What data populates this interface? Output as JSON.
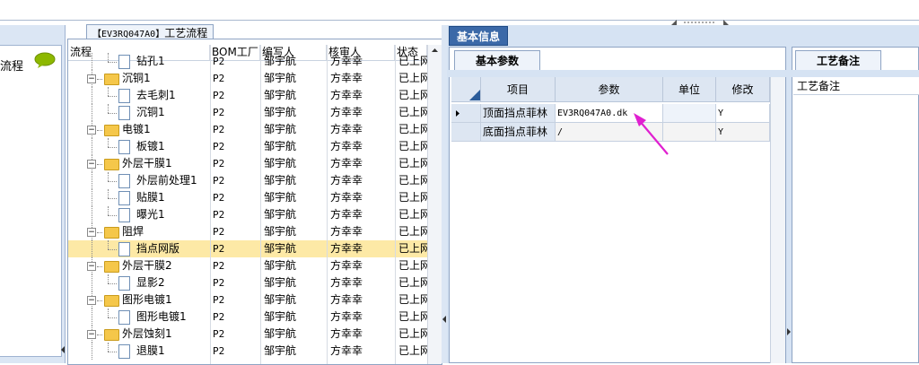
{
  "left_panel": {
    "label": "流程"
  },
  "workflow": {
    "title_code": "【EV3RQ047A0】",
    "title_text": "工艺流程",
    "columns": {
      "flow": "流程",
      "bom": "BOM工厂",
      "writer": "编写人",
      "reviewer": "核审人",
      "status": "状态"
    },
    "rows": [
      {
        "name": "钻孔1",
        "type": "doc",
        "level": 1,
        "bom": "P2",
        "writer": "邹宇航",
        "reviewer": "方幸幸",
        "status": "已上网"
      },
      {
        "name": "沉铜1",
        "type": "folder",
        "level": 0,
        "bom": "P2",
        "writer": "邹宇航",
        "reviewer": "方幸幸",
        "status": "已上网"
      },
      {
        "name": "去毛刺1",
        "type": "doc",
        "level": 1,
        "bom": "P2",
        "writer": "邹宇航",
        "reviewer": "方幸幸",
        "status": "已上网"
      },
      {
        "name": "沉铜1",
        "type": "doc",
        "level": 1,
        "bom": "P2",
        "writer": "邹宇航",
        "reviewer": "方幸幸",
        "status": "已上网"
      },
      {
        "name": "电镀1",
        "type": "folder",
        "level": 0,
        "bom": "P2",
        "writer": "邹宇航",
        "reviewer": "方幸幸",
        "status": "已上网"
      },
      {
        "name": "板镀1",
        "type": "doc",
        "level": 1,
        "bom": "P2",
        "writer": "邹宇航",
        "reviewer": "方幸幸",
        "status": "已上网"
      },
      {
        "name": "外层干膜1",
        "type": "folder",
        "level": 0,
        "bom": "P2",
        "writer": "邹宇航",
        "reviewer": "方幸幸",
        "status": "已上网"
      },
      {
        "name": "外层前处理1",
        "type": "doc",
        "level": 1,
        "bom": "P2",
        "writer": "邹宇航",
        "reviewer": "方幸幸",
        "status": "已上网"
      },
      {
        "name": "贴膜1",
        "type": "doc",
        "level": 1,
        "bom": "P2",
        "writer": "邹宇航",
        "reviewer": "方幸幸",
        "status": "已上网"
      },
      {
        "name": "曝光1",
        "type": "doc",
        "level": 1,
        "bom": "P2",
        "writer": "邹宇航",
        "reviewer": "方幸幸",
        "status": "已上网"
      },
      {
        "name": "阻焊",
        "type": "folder",
        "level": 0,
        "bom": "P2",
        "writer": "邹宇航",
        "reviewer": "方幸幸",
        "status": "已上网"
      },
      {
        "name": "挡点网版",
        "type": "doc",
        "level": 1,
        "bom": "P2",
        "writer": "邹宇航",
        "reviewer": "方幸幸",
        "status": "已上网",
        "selected": true
      },
      {
        "name": "外层干膜2",
        "type": "folder",
        "level": 0,
        "bom": "P2",
        "writer": "邹宇航",
        "reviewer": "方幸幸",
        "status": "已上网"
      },
      {
        "name": "显影2",
        "type": "doc",
        "level": 1,
        "bom": "P2",
        "writer": "邹宇航",
        "reviewer": "方幸幸",
        "status": "已上网"
      },
      {
        "name": "图形电镀1",
        "type": "folder",
        "level": 0,
        "bom": "P2",
        "writer": "邹宇航",
        "reviewer": "方幸幸",
        "status": "已上网"
      },
      {
        "name": "图形电镀1",
        "type": "doc",
        "level": 1,
        "bom": "P2",
        "writer": "邹宇航",
        "reviewer": "方幸幸",
        "status": "已上网"
      },
      {
        "name": "外层蚀刻1",
        "type": "folder",
        "level": 0,
        "bom": "P2",
        "writer": "邹宇航",
        "reviewer": "方幸幸",
        "status": "已上网"
      },
      {
        "name": "退膜1",
        "type": "doc",
        "level": 1,
        "bom": "P2",
        "writer": "邹宇航",
        "reviewer": "方幸幸",
        "status": "已上网"
      }
    ]
  },
  "basic_info": {
    "tab_label": "基本信息",
    "subtab_label": "基本参数",
    "columns": {
      "item": "项目",
      "param": "参数",
      "unit": "单位",
      "modify": "修改"
    },
    "rows": [
      {
        "item": "顶面挡点菲林",
        "param": "EV3RQ047A0.dk",
        "unit": "",
        "modify": "Y",
        "current": true
      },
      {
        "item": "底面挡点菲林",
        "param": "/",
        "unit": "",
        "modify": "Y",
        "current": false
      }
    ]
  },
  "notes": {
    "tab_label": "工艺备注",
    "header": "工艺备注"
  },
  "colors": {
    "accent_tab": "#3b69a8",
    "selection": "#fde9a6",
    "annotation_arrow": "#e020d0"
  }
}
